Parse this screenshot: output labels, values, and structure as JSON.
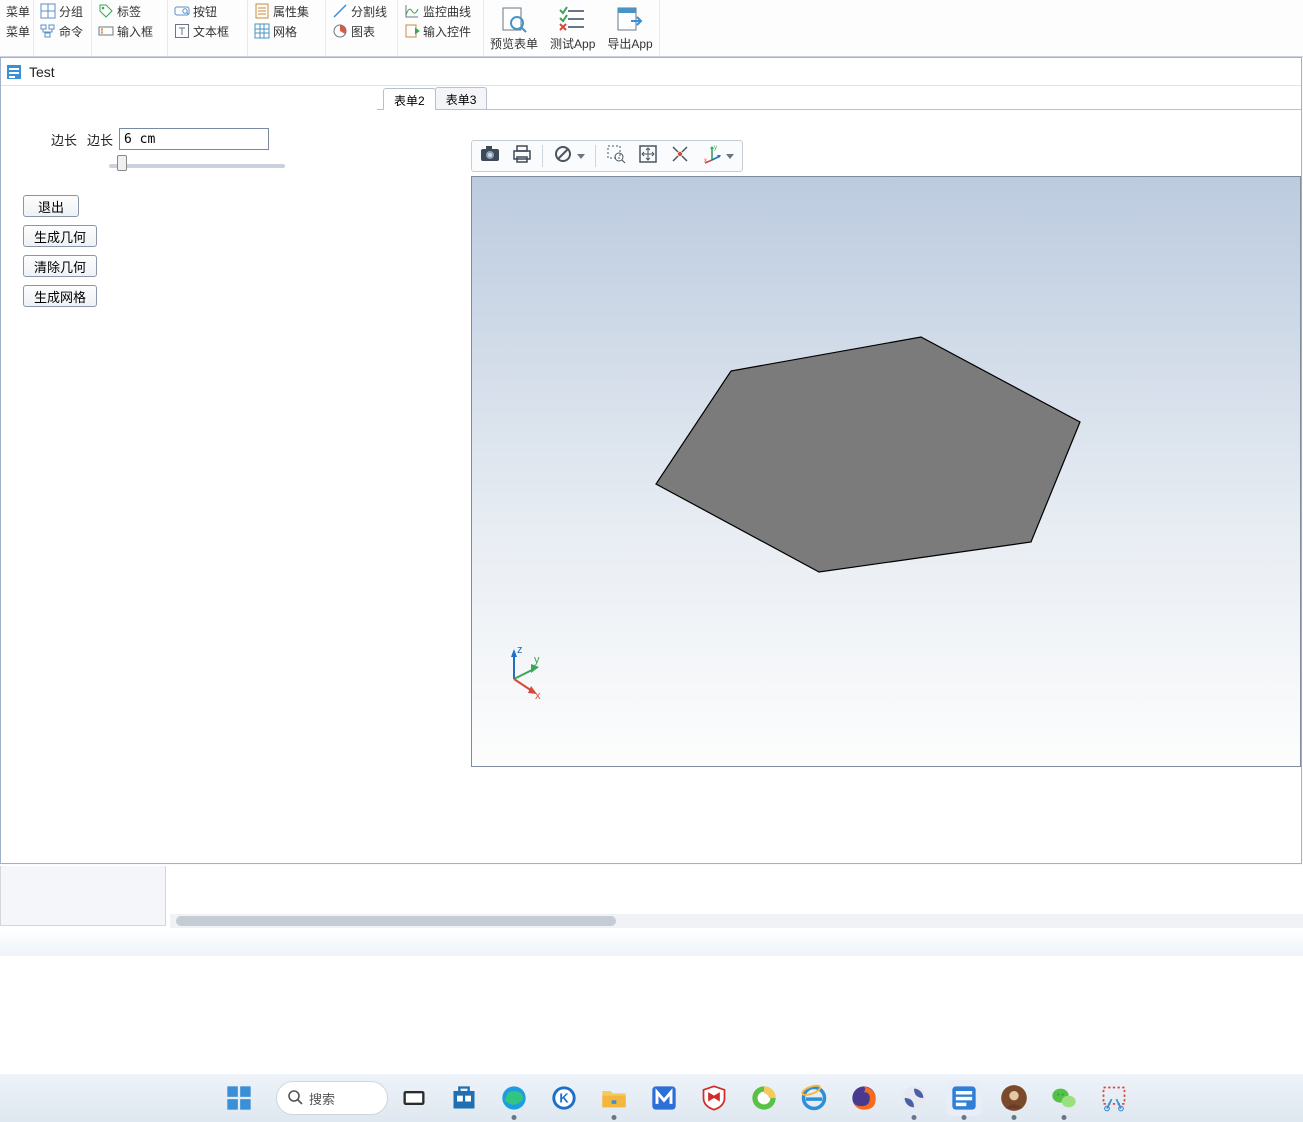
{
  "ribbon": {
    "g1": {
      "a": "菜单",
      "b": "菜单",
      "group": "分组",
      "cmd": "命令"
    },
    "g2": {
      "tag": "标签",
      "btn": "按钮",
      "input": "输入框",
      "text": "文本框"
    },
    "g3": {
      "propset": "属性集",
      "split": "分割线",
      "grid": "网格",
      "chart": "图表"
    },
    "g4": {
      "curve": "监控曲线",
      "ictrl": "输入控件"
    },
    "big": {
      "preview": "预览表单",
      "test": "测试App",
      "export": "导出App"
    }
  },
  "window": {
    "title": "Test"
  },
  "panel": {
    "edge_outer_label": "边长",
    "edge_label": "边长",
    "edge_value": "6 cm",
    "buttons": {
      "exit": "退出",
      "gen_geom": "生成几何",
      "clear_geom": "清除几何",
      "gen_mesh": "生成网格"
    }
  },
  "tabs": {
    "t1": "表单2",
    "t2": "表单3"
  },
  "axes": {
    "x": "x",
    "y": "y",
    "z": "z"
  },
  "taskbar": {
    "search": "搜索"
  }
}
